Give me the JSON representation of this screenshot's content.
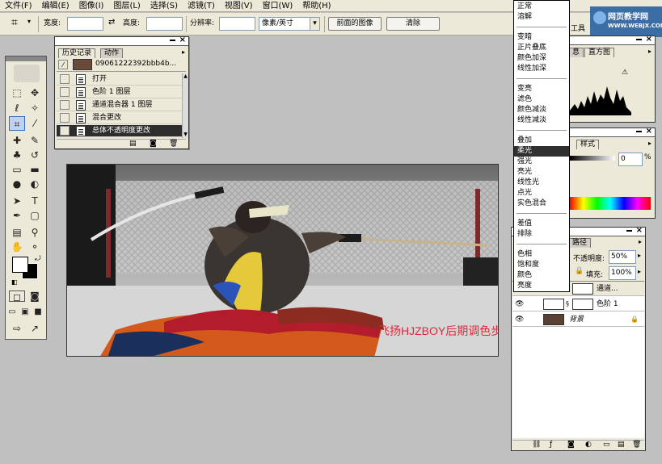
{
  "menu": [
    "文件(F)",
    "编辑(E)",
    "图像(I)",
    "图层(L)",
    "选择(S)",
    "滤镜(T)",
    "视图(V)",
    "窗口(W)",
    "帮助(H)"
  ],
  "options": {
    "width_label": "宽度:",
    "height_label": "高度:",
    "resolution_label": "分辨率:",
    "unit_value": "像素/英寸",
    "front_image_button": "前面的图像",
    "clear_button": "清除",
    "dropdown_arrow": "▾"
  },
  "watermark": {
    "line1": "网页教学网",
    "line2": "WWW.WEBJX.COM"
  },
  "history": {
    "tab_history": "历史记录",
    "tab_actions": "动作",
    "snapshot_name": "09061222392bbb4b...",
    "items": [
      "打开",
      "色阶 1 图层",
      "通道混合器 1 图层",
      "混合更改",
      "总体不透明度更改"
    ]
  },
  "blend_modes": {
    "selected": "柔光",
    "groups": [
      [
        "正常",
        "溶解"
      ],
      [
        "变暗",
        "正片叠底",
        "颜色加深",
        "线性加深"
      ],
      [
        "变亮",
        "滤色",
        "颜色减淡",
        "线性减淡"
      ],
      [
        "叠加",
        "柔光",
        "强光",
        "亮光",
        "线性光",
        "点光",
        "实色混合"
      ],
      [
        "差值",
        "排除"
      ],
      [
        "色相",
        "饱和度",
        "颜色",
        "亮度"
      ]
    ]
  },
  "navigator": {
    "tab_tools": "工具",
    "tab_info": "息",
    "tab_histogram": "直方图",
    "warning_icon": "⚠"
  },
  "styles_panel": {
    "tab_styles": "样式",
    "opacity_value": "0",
    "percent": "%"
  },
  "layers": {
    "tab_paths": "路径",
    "opacity_label": "不透明度:",
    "opacity_value": "50%",
    "fill_label": "填充:",
    "fill_value": "100%",
    "lock_label": "锁",
    "rows": [
      "通道...",
      "色阶 1",
      "背景"
    ]
  },
  "canvas": {
    "caption": "飞扬HJZBOY后期调色步骤",
    "caption_color": "#e0283c"
  },
  "colors": {
    "menubar": "#ece9d8",
    "workspace": "#c0c0c0",
    "selection": "#2f2f2f"
  }
}
